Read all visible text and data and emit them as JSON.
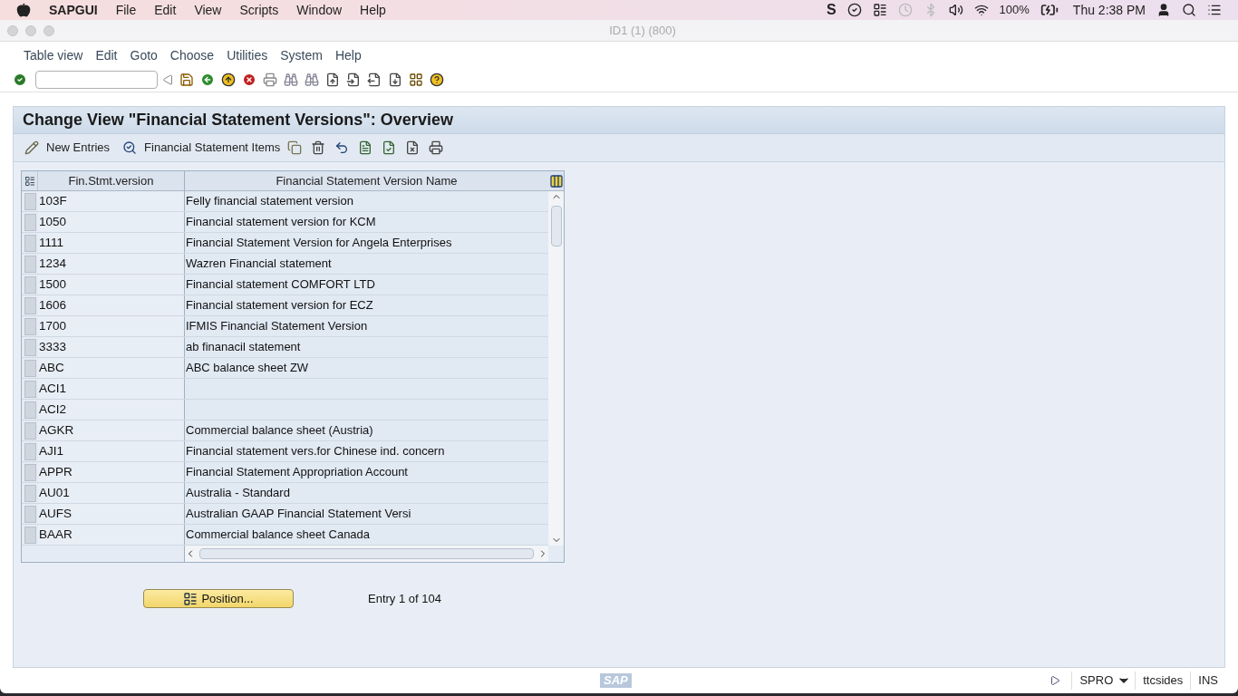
{
  "mac_menubar": {
    "app": "SAPGUI",
    "status_icon": "S",
    "menus": [
      "File",
      "Edit",
      "View",
      "Scripts",
      "Window",
      "Help"
    ],
    "battery": "100%",
    "clock": "Thu 2:38 PM"
  },
  "window": {
    "title": "ID1 (1) (800)"
  },
  "menu": [
    "Table view",
    "Edit",
    "Goto",
    "Choose",
    "Utilities",
    "System",
    "Help"
  ],
  "screen_title": "Change View \"Financial Statement Versions\": Overview",
  "app_toolbar": {
    "new_entries": "New Entries",
    "items": "Financial Statement Items"
  },
  "table": {
    "columns": [
      "Fin.Stmt.version",
      "Financial Statement Version Name"
    ],
    "rows": [
      {
        "version": "103F",
        "name": "Felly financial statement version"
      },
      {
        "version": "1050",
        "name": "Financial statement version for KCM"
      },
      {
        "version": "1111",
        "name": "Financial Statement Version for Angela Enterprises"
      },
      {
        "version": "1234",
        "name": "Wazren Financial statement"
      },
      {
        "version": "1500",
        "name": "Financial statement COMFORT LTD"
      },
      {
        "version": "1606",
        "name": "Financial statement version for ECZ"
      },
      {
        "version": "1700",
        "name": "IFMIS Financial Statement Version"
      },
      {
        "version": "3333",
        "name": "ab finanacil statement"
      },
      {
        "version": "ABC",
        "name": "ABC balance sheet ZW"
      },
      {
        "version": "ACI1"
      },
      {
        "version": "ACI2"
      },
      {
        "version": "AGKR",
        "name": "Commercial balance sheet (Austria)"
      },
      {
        "version": "AJI1",
        "name": "Financial statement vers.for Chinese ind. concern"
      },
      {
        "version": "APPR",
        "name": "Financial Statement Appropriation Account"
      },
      {
        "version": "AU01",
        "name": "Australia - Standard"
      },
      {
        "version": "AUFS",
        "name": "Australian GAAP Financial Statement Versi"
      },
      {
        "version": "BAAR",
        "name": "Commercial balance sheet Canada"
      }
    ]
  },
  "position_button": "Position...",
  "entry_info": "Entry 1 of 104",
  "status_bar": {
    "logo": "SAP",
    "transaction": "SPRO",
    "server": "ttcsides",
    "mode": "INS"
  }
}
